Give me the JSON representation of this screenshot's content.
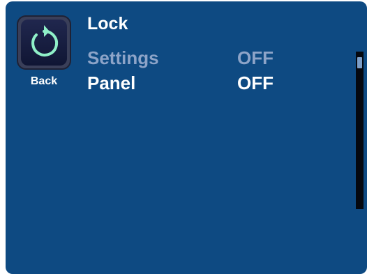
{
  "back": {
    "label": "Back",
    "icon": "back-arrow-icon"
  },
  "title": "Lock",
  "menu": [
    {
      "label": "Settings",
      "value": "OFF",
      "state": "dim"
    },
    {
      "label": "Panel",
      "value": "OFF",
      "state": "active"
    }
  ],
  "colors": {
    "background": "#0e4a82",
    "dim_text": "#8da4c8",
    "active_text": "#ffffff",
    "icon_arrow": "#8ff0c8"
  }
}
